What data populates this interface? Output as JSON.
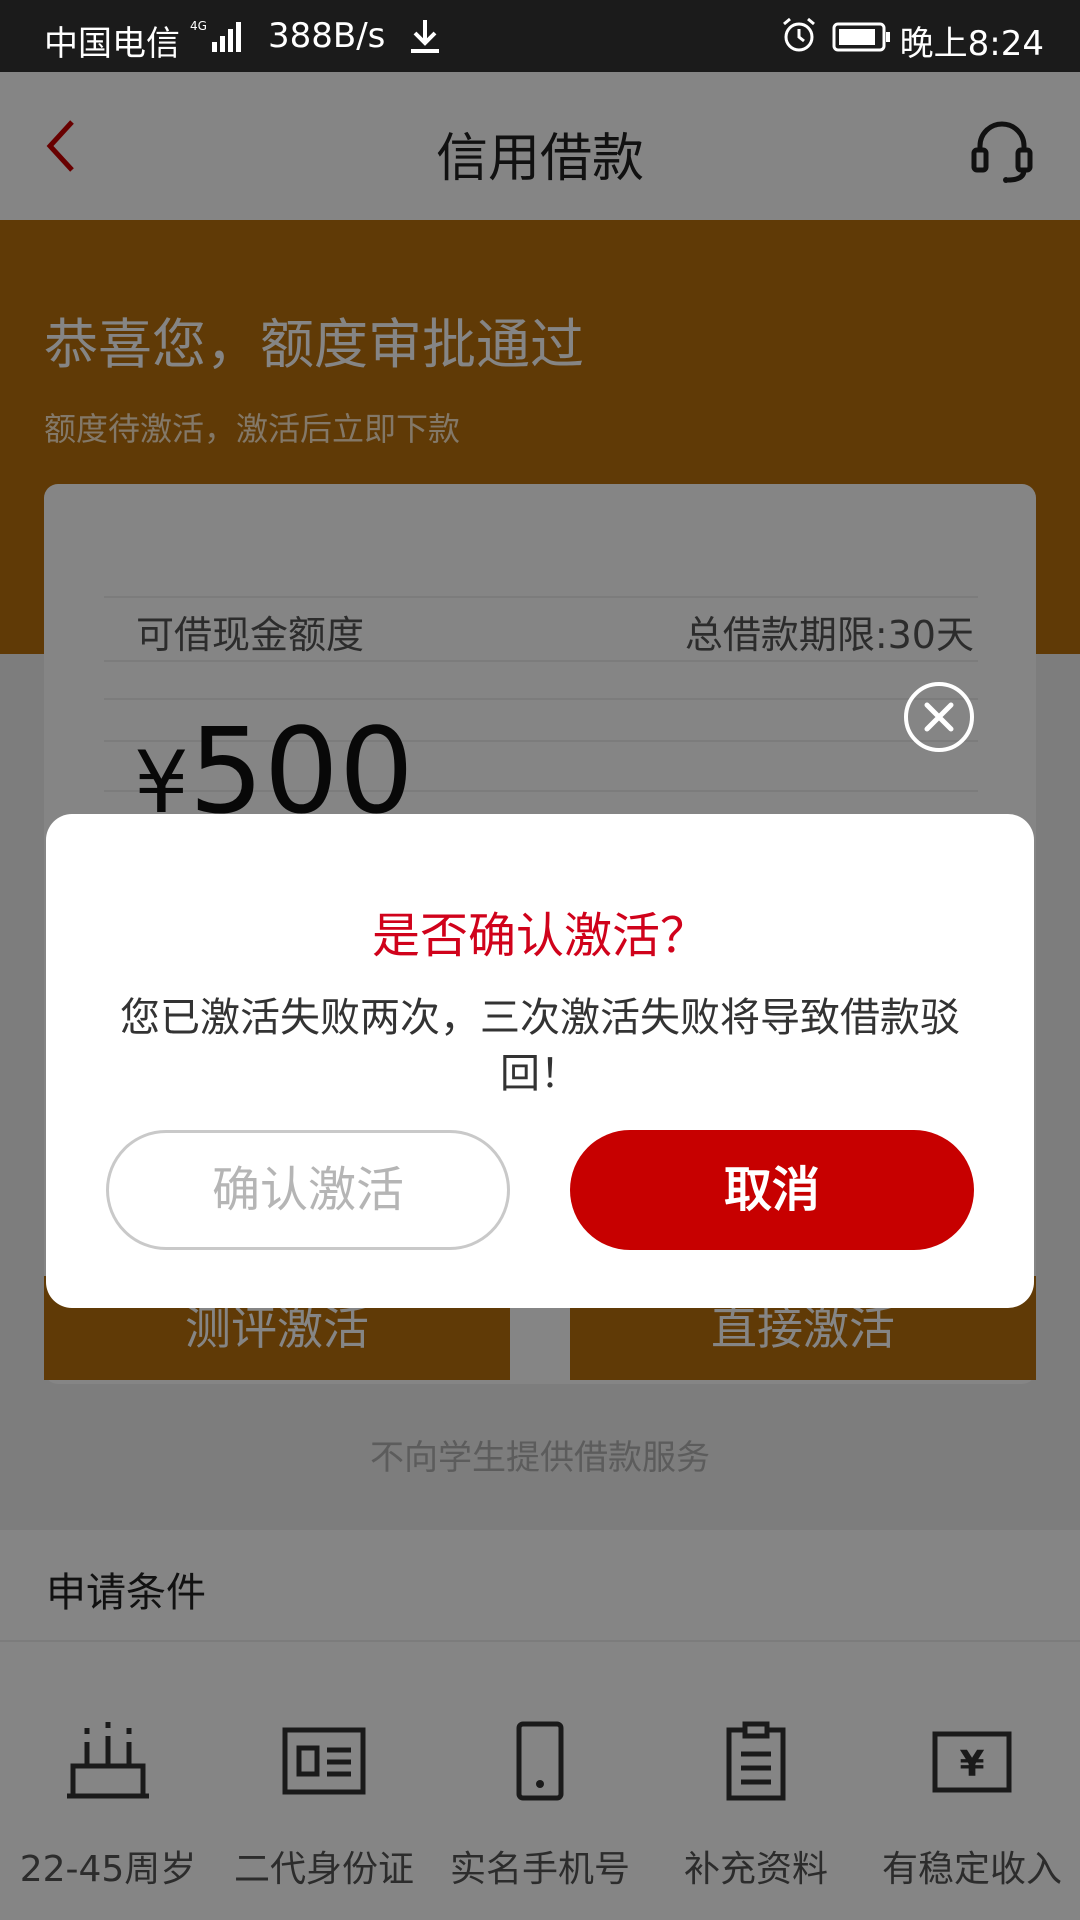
{
  "status_bar": {
    "carrier": "中国电信",
    "network": "4G",
    "speed": "388B/s",
    "time": "晚上8:24"
  },
  "nav": {
    "title": "信用借款"
  },
  "banner": {
    "headline": "恭喜您，额度审批通过",
    "subtext": "额度待激活，激活后立即下款"
  },
  "card": {
    "amount_label": "可借现金额度",
    "term_label": "总借款期限:30天",
    "currency": "¥",
    "amount": "500"
  },
  "actions": {
    "left_label": "测评激活",
    "right_label": "直接激活"
  },
  "notice": "不向学生提供借款服务",
  "conditions": {
    "title": "申请条件",
    "items": [
      {
        "label": "22-45周岁",
        "icon": "cake-icon"
      },
      {
        "label": "二代身份证",
        "icon": "id-card-icon"
      },
      {
        "label": "实名手机号",
        "icon": "phone-icon"
      },
      {
        "label": "补充资料",
        "icon": "clipboard-icon"
      },
      {
        "label": "有稳定收入",
        "icon": "income-icon"
      }
    ]
  },
  "dialog": {
    "title": "是否确认激活？",
    "message": "您已激活失败两次，三次激活失败将导致借款驳回！",
    "confirm_label": "确认激活",
    "cancel_label": "取消"
  },
  "colors": {
    "brand_orange": "#b86f0c",
    "alert_red": "#d0021b",
    "cancel_red": "#c70000"
  }
}
